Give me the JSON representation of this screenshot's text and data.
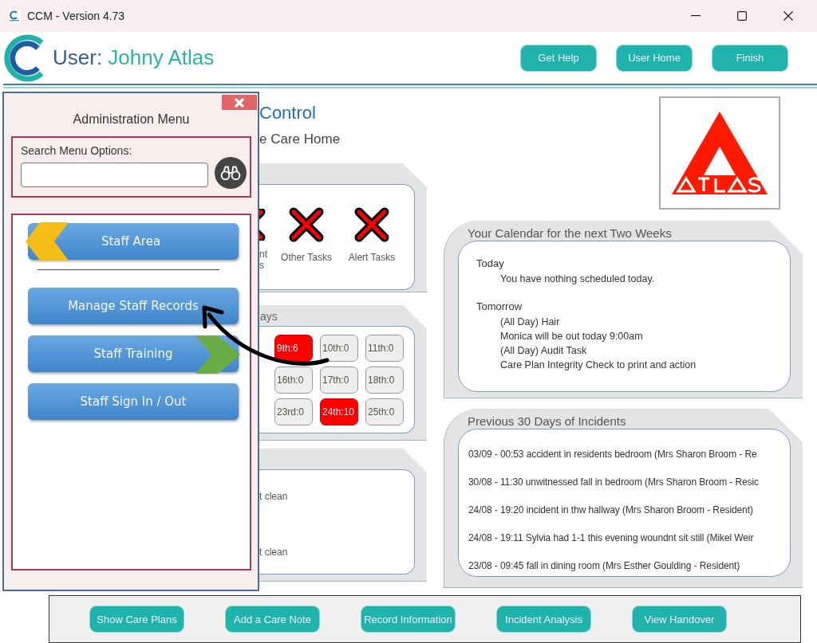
{
  "window": {
    "title": "CCM - Version 4.73"
  },
  "header": {
    "user_label": "User:",
    "user_name": "Johny Atlas",
    "buttons": [
      "Get Help",
      "User Home",
      "Finish"
    ]
  },
  "admin_menu": {
    "title": "Administration Menu",
    "search": {
      "label": "Search Menu Options:"
    },
    "items": [
      {
        "label": "Staff Area",
        "kind": "back"
      },
      {
        "label": "Manage Staff Records",
        "kind": "plain"
      },
      {
        "label": "Staff Training",
        "kind": "forward"
      },
      {
        "label": "Staff Sign In / Out",
        "kind": "plain"
      }
    ]
  },
  "page": {
    "title": "Control",
    "subtitle": "e Care Home"
  },
  "tasks": [
    {
      "lines": [
        "nt",
        "s"
      ],
      "kind": "cut"
    },
    {
      "lines": [
        "Other Tasks"
      ],
      "kind": "full"
    },
    {
      "lines": [
        "Alert Tasks"
      ],
      "kind": "full"
    }
  ],
  "days": {
    "title": "ays",
    "cells": [
      {
        "label": "9th:6",
        "alert": true
      },
      {
        "label": "10th:0",
        "alert": false
      },
      {
        "label": "11th:0",
        "alert": false
      },
      {
        "label": "16th:0",
        "alert": false
      },
      {
        "label": "17th:0",
        "alert": false
      },
      {
        "label": "18th:0",
        "alert": false
      },
      {
        "label": "23rd:0",
        "alert": false
      },
      {
        "label": "24th:10",
        "alert": true
      },
      {
        "label": "25th:0",
        "alert": false
      }
    ]
  },
  "notes": [
    "t clean",
    "t clean"
  ],
  "calendar": {
    "title": "Your Calendar for the next Two Weeks",
    "groups": [
      {
        "heading": "Today",
        "entries": [
          "You have nothing scheduled today."
        ]
      },
      {
        "heading": "Tomorrow",
        "entries": [
          "(All Day) Hair",
          "Monica will be out today 9:00am",
          "(All Day) Audit Task",
          "Care Plan Integrity Check to print and action"
        ]
      }
    ]
  },
  "incidents": {
    "title": "Previous 30 Days of Incidents",
    "entries": [
      "03/09 - 00:53 accident in residents bedroom (Mrs Sharon Broom - Re",
      "30/08 - 11:30 unwitnessed fall in bedroom (Mrs Sharon Broom - Resic",
      "24/08 - 19:20 incident in thw hallway  (Mrs Sharon Broom - Resident)",
      "24/08 - 19:11 Sylvia had 1-1 this evening woundnt sit still (Mikel Weir",
      "23/08 - 09:45 fall in dining room (Mrs Esther Goulding - Resident)"
    ]
  },
  "footer_buttons": [
    "Show Care Plans",
    "Add a Care Note",
    "Record Information",
    "Incident Analysis",
    "View Handover"
  ]
}
